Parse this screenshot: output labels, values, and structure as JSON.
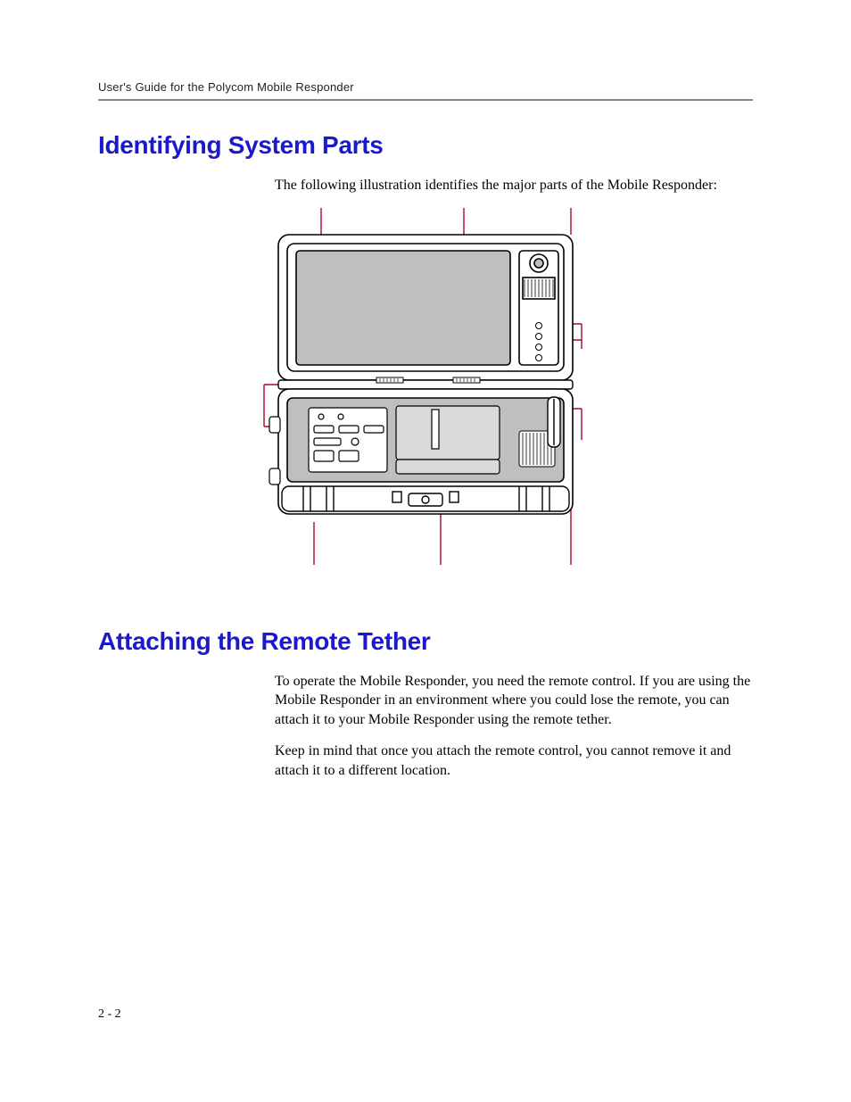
{
  "header": {
    "running_head": "User's Guide for the Polycom Mobile Responder"
  },
  "section1": {
    "title": "Identifying System Parts",
    "intro": "The following illustration identifies the major parts of the Mobile Responder:"
  },
  "section2": {
    "title": "Attaching the Remote Tether",
    "p1": "To operate the Mobile Responder, you need the remote control. If you are using the Mobile Responder in an environment where you could lose the remote, you can attach it to your Mobile Responder using the remote tether.",
    "p2": "Keep in mind that once you attach the remote control, you cannot remove it and attach it to a different location."
  },
  "footer": {
    "page_number": "2 - 2"
  },
  "colors": {
    "heading": "#1a1acc",
    "rule": "#888888",
    "callout": "#a80826"
  }
}
